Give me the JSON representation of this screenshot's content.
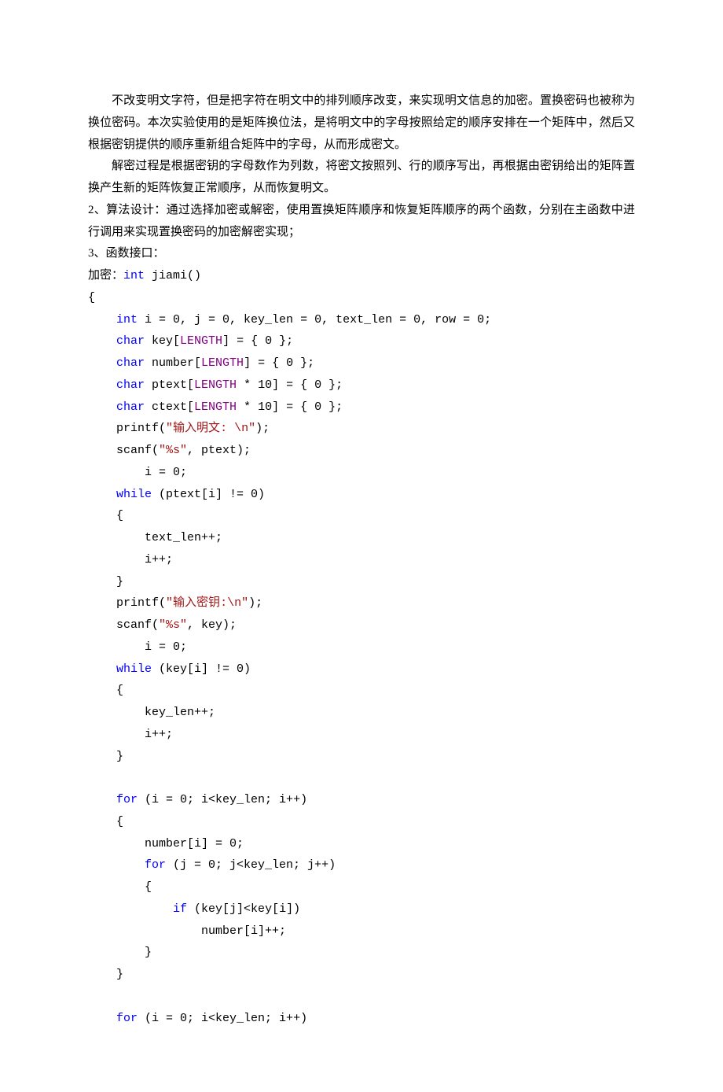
{
  "para1": "不改变明文字符，但是把字符在明文中的排列顺序改变，来实现明文信息的加密。置换密码也被称为换位密码。本次实验使用的是矩阵换位法，是将明文中的字母按照给定的顺序安排在一个矩阵中，然后又根据密钥提供的顺序重新组合矩阵中的字母，从而形成密文。",
  "para2": "解密过程是根据密钥的字母数作为列数，将密文按照列、行的顺序写出，再根据由密钥给出的矩阵置换产生新的矩阵恢复正常顺序，从而恢复明文。",
  "para3": "2、算法设计：通过选择加密或解密，使用置换矩阵顺序和恢复矩阵顺序的两个函数，分别在主函数中进行调用来实现置换密码的加密解密实现；",
  "para4": "3、函数接口：",
  "encrypt_label_prefix": "加密：",
  "code": {
    "fn_ret_kw": "int",
    "fn_sig_rest": " jiami()",
    "lbrace": "{",
    "decl_int_kw": "int",
    "decl_int_rest": " i = 0, j = 0, key_len = 0, text_len = 0, row = 0;",
    "char_kw": "char",
    "length_mac": "LENGTH",
    "key_decl_a": " key[",
    "key_decl_b": "] = { 0 };",
    "number_decl_a": " number[",
    "number_decl_b": "] = { 0 };",
    "ptext_decl_a": " ptext[",
    "ptext_decl_b": " * 10] = { 0 };",
    "ctext_decl_a": " ctext[",
    "ctext_decl_b": " * 10] = { 0 };",
    "printf": "printf(",
    "scanf": "scanf(",
    "close_semi": ");",
    "str_input_plain_a": "\"",
    "str_input_plain_mid": "输入明文",
    "str_input_plain_b": ": \\n\"",
    "str_input_key_a": "\"",
    "str_input_key_mid": "输入密钥",
    "str_input_key_b": ":\\n\"",
    "str_pct_s": "\"%s\"",
    "scanf_ptext_rest": ", ptext);",
    "scanf_key_rest": ", key);",
    "i_eq_0": "        i = 0;",
    "while_kw": "while",
    "while_ptext_rest": " (ptext[i] != 0)",
    "while_key_rest": " (key[i] != 0)",
    "open_brace_inner": "    {",
    "text_len_pp": "        text_len++;",
    "key_len_pp": "        key_len++;",
    "i_pp": "        i++;",
    "close_brace_inner": "    }",
    "for_kw": "for",
    "for_outer_rest": " (i = 0; i<key_len; i++)",
    "number_i_0": "        number[i] = 0;",
    "for_inner_rest": " (j = 0; j<key_len; j++)",
    "open_brace_inner2": "        {",
    "if_kw": "if",
    "if_cond_rest": " (key[j]<key[i])",
    "number_i_pp": "                number[i]++;",
    "close_brace_inner2": "        }",
    "close_brace_inner3": "    }"
  }
}
